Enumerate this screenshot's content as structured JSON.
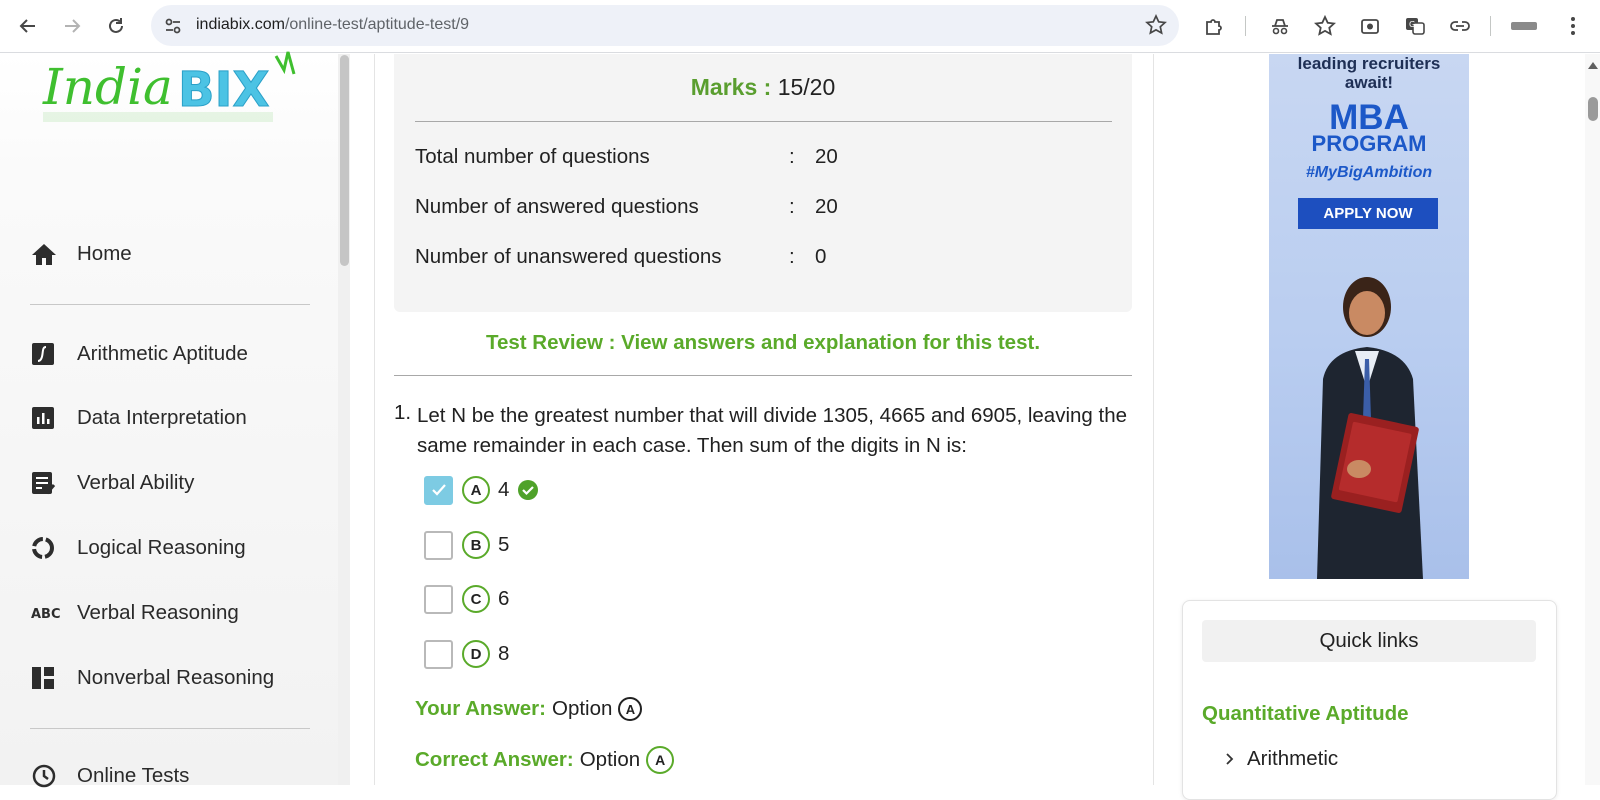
{
  "browser": {
    "url_host": "indiabix.com",
    "url_path": "/online-test/aptitude-test/9",
    "back_icon": "arrow-left-icon",
    "forward_icon": "arrow-right-icon",
    "reload_icon": "reload-icon"
  },
  "sidebar": {
    "logo_text_a": "India",
    "logo_text_b": "BIX",
    "home": "Home",
    "items": [
      {
        "label": "Arithmetic Aptitude",
        "icon": "function-icon"
      },
      {
        "label": "Data Interpretation",
        "icon": "bar-chart-icon"
      },
      {
        "label": "Verbal Ability",
        "icon": "checklist-icon"
      },
      {
        "label": "Logical Reasoning",
        "icon": "cycle-icon"
      },
      {
        "label": "Verbal Reasoning",
        "icon": "abc-icon"
      },
      {
        "label": "Nonverbal Reasoning",
        "icon": "dashboard-icon"
      }
    ],
    "online_tests": "Online Tests"
  },
  "score": {
    "marks_label": "Marks :",
    "marks_value": "15/20",
    "rows": [
      {
        "label": "Total number of questions",
        "sep": ":",
        "value": "20"
      },
      {
        "label": "Number of answered questions",
        "sep": ":",
        "value": "20"
      },
      {
        "label": "Number of unanswered questions",
        "sep": ":",
        "value": "0"
      }
    ]
  },
  "review_link": "Test Review : View answers and explanation for this test.",
  "question": {
    "number": "1.",
    "text": "Let N be the greatest number that will divide 1305, 4665 and 6905, leaving the same remainder in each case. Then sum of the digits in N is:",
    "options": [
      {
        "letter": "A",
        "text": "4",
        "checked": true,
        "correct": true
      },
      {
        "letter": "B",
        "text": "5",
        "checked": false,
        "correct": false
      },
      {
        "letter": "C",
        "text": "6",
        "checked": false,
        "correct": false
      },
      {
        "letter": "D",
        "text": "8",
        "checked": false,
        "correct": false
      }
    ],
    "your_answer_label": "Your Answer:",
    "your_answer_text": "Option",
    "your_answer_letter": "A",
    "correct_answer_label": "Correct Answer:",
    "correct_answer_text": "Option",
    "correct_answer_letter": "A"
  },
  "ad": {
    "line1": "leading recruiters",
    "line2": "await!",
    "mba": "MBA",
    "program": "PROGRAM",
    "tag": "#MyBigAmbition",
    "cta": "APPLY NOW"
  },
  "quick_links": {
    "title": "Quick links",
    "section": "Quantitative Aptitude",
    "link": "Arithmetic"
  }
}
